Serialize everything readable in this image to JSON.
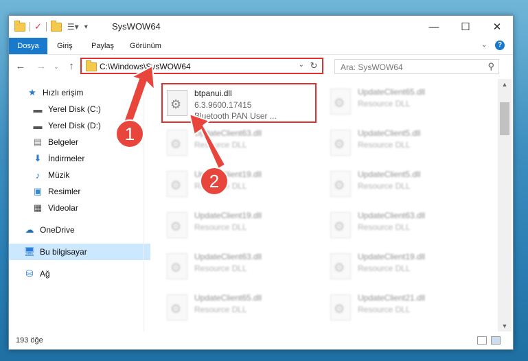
{
  "window": {
    "title": "SysWOW64"
  },
  "ribbon": {
    "tabs": [
      "Dosya",
      "Giriş",
      "Paylaş",
      "Görünüm"
    ]
  },
  "address": {
    "path": "C:\\Windows\\SysWOW64"
  },
  "search": {
    "placeholder": "Ara: SysWOW64"
  },
  "sidebar": {
    "items": [
      {
        "label": "Hızlı erişim",
        "icon": "star-icon"
      },
      {
        "label": "Yerel Disk (C:)",
        "icon": "drive-icon"
      },
      {
        "label": "Yerel Disk (D:)",
        "icon": "drive-icon"
      },
      {
        "label": "Belgeler",
        "icon": "document-icon"
      },
      {
        "label": "İndirmeler",
        "icon": "download-icon"
      },
      {
        "label": "Müzik",
        "icon": "music-icon"
      },
      {
        "label": "Resimler",
        "icon": "pictures-icon"
      },
      {
        "label": "Videolar",
        "icon": "video-icon"
      },
      {
        "label": "OneDrive",
        "icon": "cloud-icon"
      },
      {
        "label": "Bu bilgisayar",
        "icon": "computer-icon"
      },
      {
        "label": "Ağ",
        "icon": "network-icon"
      }
    ]
  },
  "files": [
    {
      "name": "btpanui.dll",
      "version": "6.3.9600.17415",
      "desc": "Bluetooth PAN User ..."
    },
    {
      "name": "UpdateClient65.dll",
      "version": "Resource DLL",
      "desc": ""
    },
    {
      "name": "UpdateClient63.dll",
      "version": "Resource DLL",
      "desc": ""
    },
    {
      "name": "UpdateClient5.dll",
      "version": "Resource DLL",
      "desc": ""
    },
    {
      "name": "UpdateClient19.dll",
      "version": "Resource DLL",
      "desc": ""
    },
    {
      "name": "UpdateClient5.dll",
      "version": "Resource DLL",
      "desc": ""
    },
    {
      "name": "UpdateClient19.dll",
      "version": "Resource DLL",
      "desc": ""
    },
    {
      "name": "UpdateClient63.dll",
      "version": "Resource DLL",
      "desc": ""
    },
    {
      "name": "UpdateClient63.dll",
      "version": "Resource DLL",
      "desc": ""
    },
    {
      "name": "UpdateClient19.dll",
      "version": "Resource DLL",
      "desc": ""
    },
    {
      "name": "UpdateClient65.dll",
      "version": "Resource DLL",
      "desc": ""
    },
    {
      "name": "UpdateClient21.dll",
      "version": "Resource DLL",
      "desc": ""
    }
  ],
  "status": {
    "count": "193 öğe"
  },
  "annotations": {
    "one": "1",
    "two": "2",
    "color": "#e8453c"
  }
}
